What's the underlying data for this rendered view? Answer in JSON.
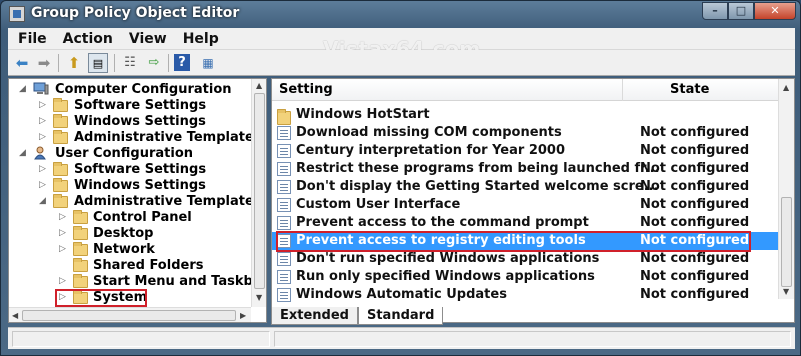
{
  "window": {
    "title": "Group Policy Object Editor"
  },
  "watermark": "Vistax64.com",
  "menu": [
    "File",
    "Action",
    "View",
    "Help"
  ],
  "toolbar": {
    "buttons": [
      "back-icon",
      "forward-icon",
      "up-folder-icon",
      "show-hide-tree-icon",
      "properties-icon",
      "export-list-icon",
      "help-icon",
      "extended-view-icon"
    ]
  },
  "tree": [
    {
      "label": "Computer Configuration",
      "level": 0,
      "icon": "computer-icon",
      "expanded": true
    },
    {
      "label": "Software Settings",
      "level": 1,
      "icon": "folder-icon",
      "expanded": false
    },
    {
      "label": "Windows Settings",
      "level": 1,
      "icon": "folder-icon",
      "expanded": false
    },
    {
      "label": "Administrative Templates",
      "level": 1,
      "icon": "folder-icon",
      "expanded": false
    },
    {
      "label": "User Configuration",
      "level": 0,
      "icon": "user-icon",
      "expanded": true
    },
    {
      "label": "Software Settings",
      "level": 1,
      "icon": "folder-icon",
      "expanded": false
    },
    {
      "label": "Windows Settings",
      "level": 1,
      "icon": "folder-icon",
      "expanded": false
    },
    {
      "label": "Administrative Templates",
      "level": 1,
      "icon": "folder-icon",
      "expanded": true
    },
    {
      "label": "Control Panel",
      "level": 2,
      "icon": "folder-icon",
      "expanded": false
    },
    {
      "label": "Desktop",
      "level": 2,
      "icon": "folder-icon",
      "expanded": false
    },
    {
      "label": "Network",
      "level": 2,
      "icon": "folder-icon",
      "expanded": false
    },
    {
      "label": "Shared Folders",
      "level": 2,
      "icon": "folder-icon",
      "expanded": null
    },
    {
      "label": "Start Menu and Taskbar",
      "level": 2,
      "icon": "folder-icon",
      "expanded": false
    },
    {
      "label": "System",
      "level": 2,
      "icon": "folder-icon",
      "expanded": false,
      "highlighted": true
    }
  ],
  "list": {
    "columns": {
      "setting": "Setting",
      "state": "State"
    },
    "rows": [
      {
        "setting": "Windows HotStart",
        "state": "",
        "icon": "folder-icon"
      },
      {
        "setting": "Download missing COM components",
        "state": "Not configured",
        "icon": "policy-icon"
      },
      {
        "setting": "Century interpretation for Year 2000",
        "state": "Not configured",
        "icon": "policy-icon"
      },
      {
        "setting": "Restrict these programs from being launched fr...",
        "state": "Not configured",
        "icon": "policy-icon"
      },
      {
        "setting": "Don't display the Getting Started welcome scre...",
        "state": "Not configured",
        "icon": "policy-icon"
      },
      {
        "setting": "Custom User Interface",
        "state": "Not configured",
        "icon": "policy-icon"
      },
      {
        "setting": "Prevent access to the command prompt",
        "state": "Not configured",
        "icon": "policy-icon"
      },
      {
        "setting": "Prevent access to registry editing tools",
        "state": "Not configured",
        "icon": "policy-icon",
        "selected": true
      },
      {
        "setting": "Don't run specified Windows applications",
        "state": "Not configured",
        "icon": "policy-icon"
      },
      {
        "setting": "Run only specified Windows applications",
        "state": "Not configured",
        "icon": "policy-icon"
      },
      {
        "setting": "Windows Automatic Updates",
        "state": "Not configured",
        "icon": "policy-icon"
      }
    ]
  },
  "tabs": [
    {
      "label": "Extended",
      "active": false
    },
    {
      "label": "Standard",
      "active": true
    }
  ],
  "colors": {
    "selection": "#3399ff",
    "highlight_box": "#d0202a"
  }
}
